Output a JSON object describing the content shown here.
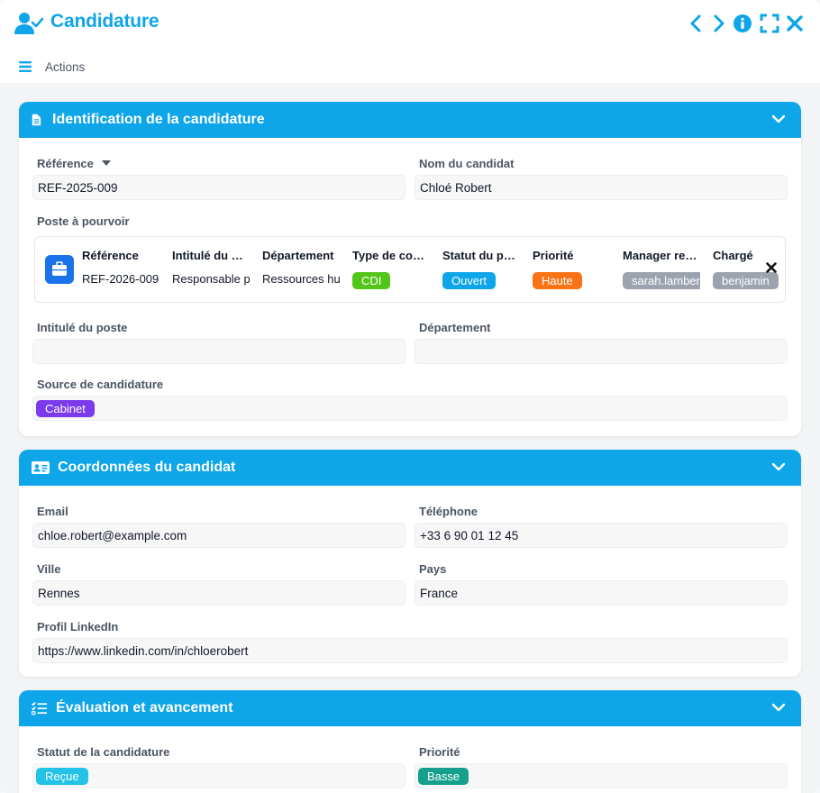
{
  "header": {
    "title": "Candidature"
  },
  "actions": {
    "label": "Actions"
  },
  "sections": {
    "identification": {
      "title": "Identification de la candidature",
      "reference_label": "Référence",
      "reference_value": "REF-2025-009",
      "nom_label": "Nom du candidat",
      "nom_value": "Chloé Robert",
      "poste_label": "Poste à pourvoir",
      "poste_card": {
        "columns": [
          {
            "header": "Référence",
            "value": "REF-2026-009"
          },
          {
            "header": "Intitulé du poste",
            "value": "Responsable p"
          },
          {
            "header": "Département",
            "value": "Ressources humaines"
          },
          {
            "header": "Type de contrat",
            "badge": "CDI",
            "badge_color": "#52c41a"
          },
          {
            "header": "Statut du poste",
            "badge": "Ouvert",
            "badge_color": "#0ea5e9"
          },
          {
            "header": "Priorité",
            "badge": "Haute",
            "badge_color": "#f97316"
          },
          {
            "header": "Manager responsable",
            "badge": "sarah.lambert",
            "badge_color": "#9ca3af"
          },
          {
            "header": "Chargé",
            "badge": "benjamin",
            "badge_color": "#9ca3af"
          }
        ]
      },
      "intitule_label": "Intitulé du poste",
      "intitule_value": "",
      "departement_label": "Département",
      "departement_value": "",
      "source_label": "Source de candidature",
      "source_badge": "Cabinet",
      "source_color": "#7c3aed"
    },
    "coordonnees": {
      "title": "Coordonnées du candidat",
      "email_label": "Email",
      "email_value": "chloe.robert@example.com",
      "telephone_label": "Téléphone",
      "telephone_value": "+33 6 90 01 12 45",
      "ville_label": "Ville",
      "ville_value": "Rennes",
      "pays_label": "Pays",
      "pays_value": "France",
      "linkedin_label": "Profil LinkedIn",
      "linkedin_value": "https://www.linkedin.com/in/chloerobert"
    },
    "evaluation": {
      "title": "Évaluation et avancement",
      "statut_label": "Statut de la candidature",
      "statut_badge": "Reçue",
      "statut_color": "#22c3e6",
      "priorite_label": "Priorité",
      "priorite_badge": "Basse",
      "priorite_color": "#14a08c"
    }
  },
  "colors": {
    "accent": "#0ea5e9",
    "card_icon": "#1a73e8"
  },
  "icons": {
    "app": "user-check-icon",
    "prev": "chevron-left-icon",
    "next": "chevron-right-icon",
    "info": "info-icon",
    "fullscreen": "expand-icon",
    "close": "close-icon",
    "menu": "hamburger-icon"
  }
}
